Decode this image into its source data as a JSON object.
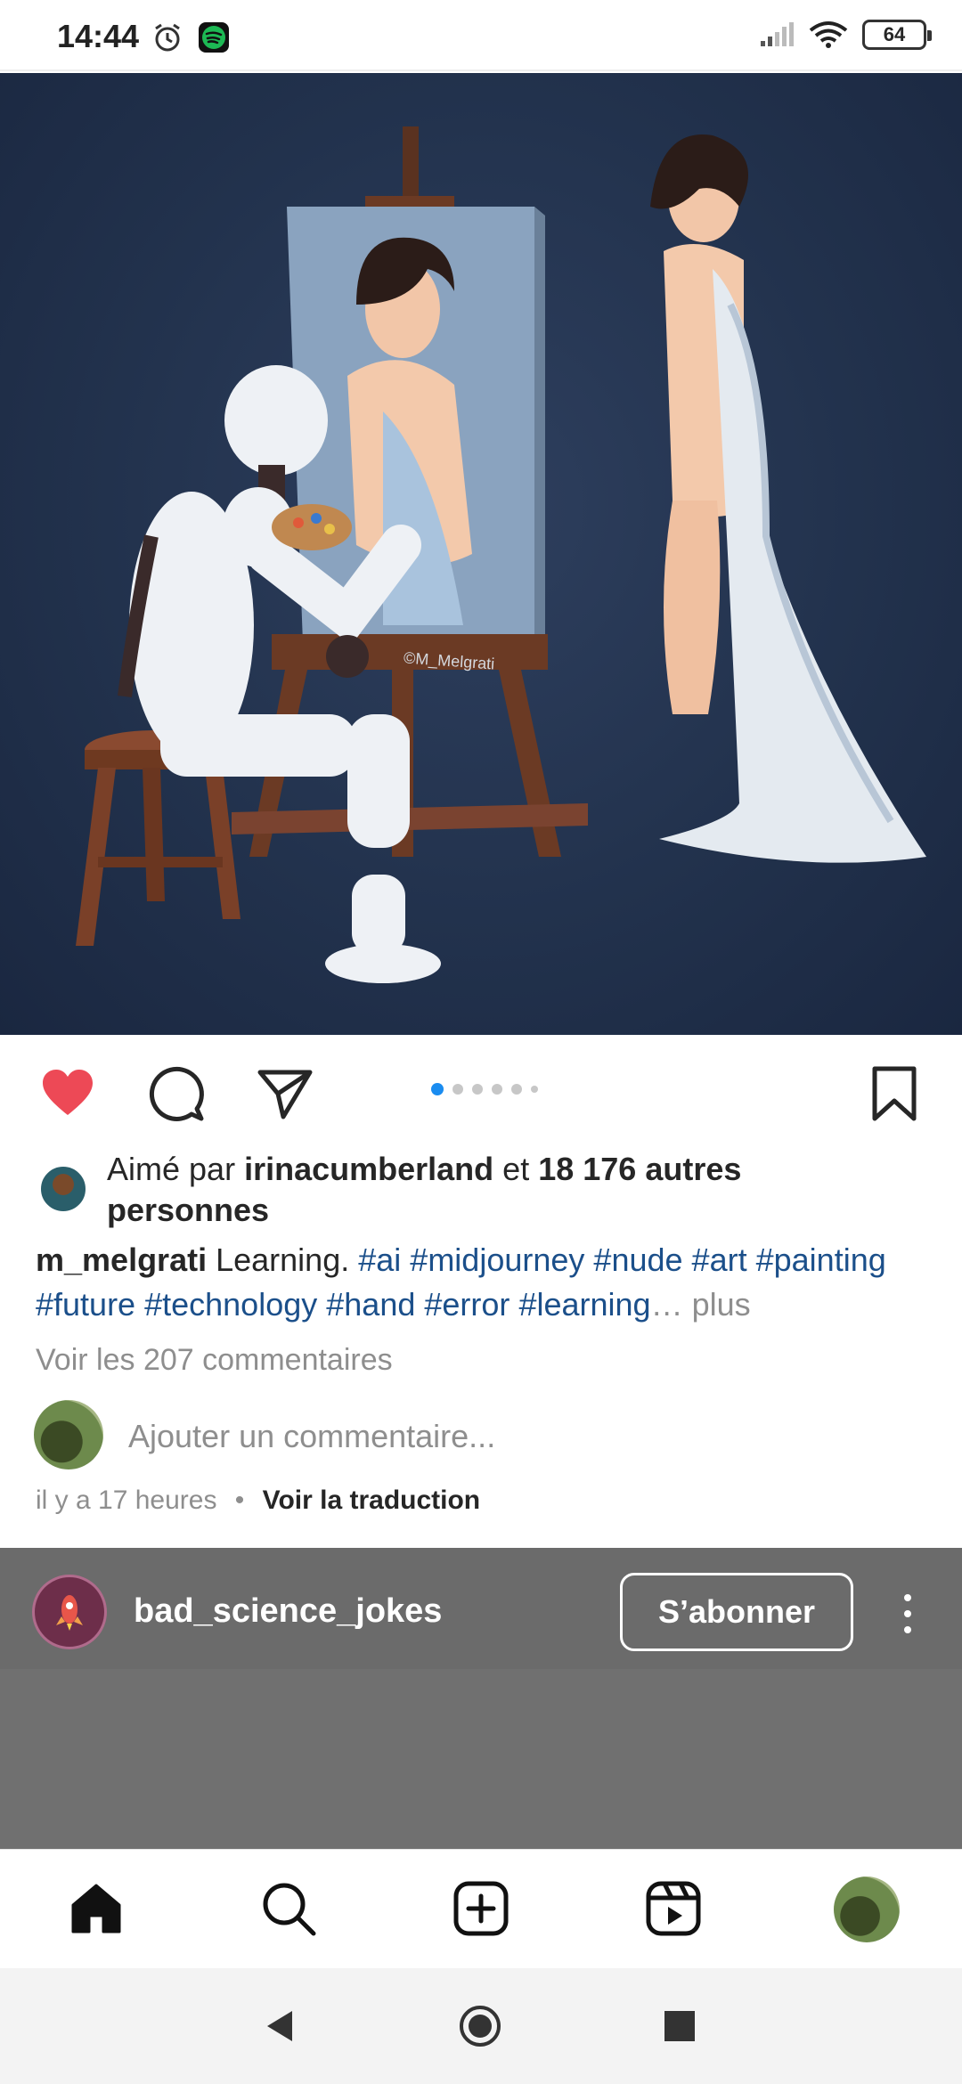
{
  "status_bar": {
    "time": "14:44",
    "battery": "64",
    "icons": [
      "alarm-icon",
      "spotify-icon",
      "signal-icon",
      "wifi-icon",
      "battery-icon"
    ]
  },
  "post": {
    "image": {
      "description_icon": "illustration-robot-painting",
      "watermark": "©M_Melgrati"
    },
    "carousel": {
      "total": 6,
      "active": 1
    },
    "likes": {
      "prefix": "Aimé par",
      "user": "irinacumberland",
      "middle": "et",
      "count": "18 176 autres personnes"
    },
    "caption": {
      "username": "m_melgrati",
      "text": "Learning.",
      "tags": [
        "#ai",
        "#midjourney",
        "#nude",
        "#art",
        "#painting",
        "#future",
        "#technology",
        "#hand",
        "#error",
        "#learning"
      ],
      "ellipsis": "…",
      "more": "plus"
    },
    "view_comments": "Voir les 207 commentaires",
    "comment_placeholder": "Ajouter un commentaire...",
    "time_ago": "il y a 17 heures",
    "separator": "•",
    "translate": "Voir la traduction"
  },
  "next_post": {
    "username": "bad_science_jokes",
    "follow_label": "S’abonner"
  },
  "colors": {
    "like": "#ed4956",
    "hashtag": "#1b4f8a",
    "carousel_active": "#1a8cf0"
  },
  "tabbar": [
    "home-icon",
    "search-icon",
    "create-icon",
    "reels-icon",
    "profile-avatar"
  ]
}
